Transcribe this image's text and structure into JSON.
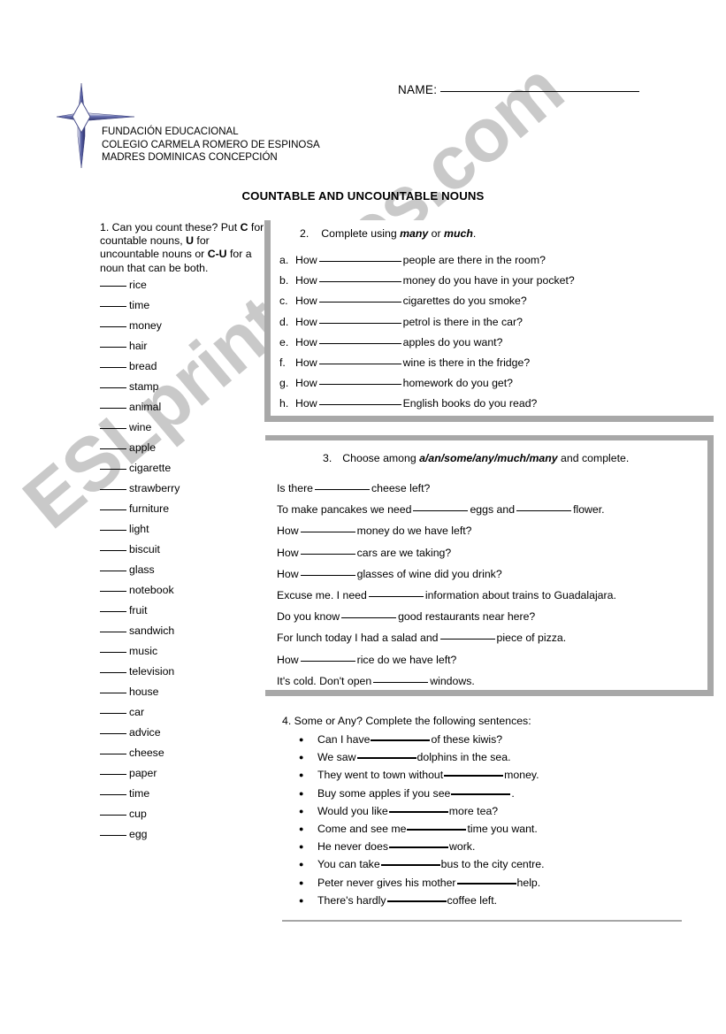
{
  "header": {
    "name_label": "NAME:",
    "logo_icon": "four-pointed-star-cross-logo",
    "school_lines": [
      "FUNDACIÓN EDUCACIONAL",
      "COLEGIO CARMELA ROMERO DE ESPINOSA",
      "MADRES DOMINICAS CONCEPCIÓN"
    ]
  },
  "title": "COUNTABLE AND UNCOUNTABLE NOUNS",
  "watermark": {
    "text": "ESLprintables.com",
    "color": "#c9c9c9"
  },
  "section1": {
    "number": "1.",
    "instruction_parts": {
      "p1": "1.  Can you count these? Put ",
      "b1": "C",
      "p2": " for countable nouns, ",
      "b2": "U",
      "p3": " for uncountable nouns or ",
      "b3": "C-U",
      "p4": " for a noun that can be both."
    },
    "words": [
      "rice",
      "time",
      "money",
      "hair",
      "bread",
      "stamp",
      "animal",
      "wine",
      "apple",
      "cigarette",
      "strawberry",
      "furniture",
      "light",
      "biscuit",
      "glass",
      "notebook",
      "fruit",
      "sandwich",
      "music",
      "television",
      "house",
      "car",
      "advice",
      "cheese",
      "paper",
      "time",
      "cup",
      "egg"
    ]
  },
  "section2": {
    "number": "2.",
    "title_pre": "Complete using ",
    "title_bold1": "many",
    "title_mid": " or ",
    "title_bold2": "much",
    "title_post": ".",
    "items": [
      {
        "letter": "a.",
        "pre": "How",
        "post": "people are there in the room?"
      },
      {
        "letter": "b.",
        "pre": "How",
        "post": "money do you have in your pocket?"
      },
      {
        "letter": "c.",
        "pre": "How",
        "post": "cigarettes do you smoke?"
      },
      {
        "letter": "d.",
        "pre": "How",
        "post": "petrol is there in the car?"
      },
      {
        "letter": "e.",
        "pre": "How",
        "post": "apples do you want?"
      },
      {
        "letter": "f.",
        "pre": "How",
        "post": "wine is there in the fridge?"
      },
      {
        "letter": "g.",
        "pre": "How",
        "post": "homework do you get?"
      },
      {
        "letter": "h.",
        "pre": "How",
        "post": "English books do you read?"
      }
    ]
  },
  "section3": {
    "number": "3.",
    "title_pre": "Choose among ",
    "title_bold": "a/an/some/any/much/many",
    "title_post": " and complete.",
    "items": [
      {
        "pre": "Is there",
        "post": "cheese left?"
      },
      {
        "pre": "To make pancakes we need",
        "mid": "eggs and",
        "post": "flower.",
        "two_blanks": true
      },
      {
        "pre": "How",
        "post": "money do we have left?"
      },
      {
        "pre": "How",
        "post": "cars are we taking?"
      },
      {
        "pre": "How",
        "post": "glasses of wine did you drink?"
      },
      {
        "pre": "Excuse me. I need",
        "post": "information about trains to Guadalajara."
      },
      {
        "pre": "Do you know",
        "post": "good restaurants near here?"
      },
      {
        "pre": "For lunch today I had a salad and",
        "post": "piece of pizza."
      },
      {
        "pre": "How",
        "post": "rice do we have left?"
      },
      {
        "pre": "It's cold. Don't open",
        "post": "windows."
      }
    ]
  },
  "section4": {
    "title": "4. Some or Any? Complete the following sentences:",
    "items": [
      {
        "pre": "Can I have",
        "post": "of these kiwis?"
      },
      {
        "pre": " We saw",
        "post": "dolphins in the sea."
      },
      {
        "pre": "They went to town without",
        "post": "money."
      },
      {
        "pre": "Buy some apples if you see",
        "post": "."
      },
      {
        "pre": "Would you like",
        "post": "more tea?"
      },
      {
        "pre": "Come and see me",
        "post": "time you want."
      },
      {
        "pre": "He never does",
        "post": "work."
      },
      {
        "pre": "You can take",
        "post": "bus to the city centre."
      },
      {
        "pre": "Peter never gives his mother",
        "post": "help."
      },
      {
        "pre": " There's hardly",
        "post": "coffee left."
      }
    ]
  }
}
